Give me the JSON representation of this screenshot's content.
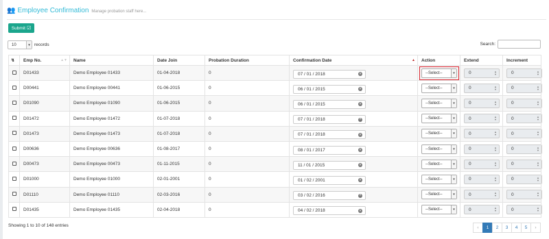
{
  "header": {
    "title": "Employee Confirmation",
    "subtitle": "Manage probation staff here...",
    "icon": "users-icon"
  },
  "toolbar": {
    "submit_label": "Submit"
  },
  "length": {
    "value": "10",
    "label": "records"
  },
  "search": {
    "label": "Search:",
    "value": ""
  },
  "columns": [
    "Emp No.",
    "Name",
    "Date Join",
    "Probation Duration",
    "Confirmation Date",
    "Action",
    "Extend",
    "Increment"
  ],
  "rows": [
    {
      "emp_no": "D01433",
      "name": "Demo Employee 01433",
      "date_join": "01-04-2018",
      "probation": "0",
      "confirm_date": "07 / 01 / 2018",
      "action": "--Select--",
      "extend": "0",
      "increment": "0"
    },
    {
      "emp_no": "D00441",
      "name": "Demo Employee 00441",
      "date_join": "01-06-2015",
      "probation": "0",
      "confirm_date": "06 / 01 / 2015",
      "action": "--Select--",
      "extend": "0",
      "increment": "0"
    },
    {
      "emp_no": "D01090",
      "name": "Demo Employee 01090",
      "date_join": "01-06-2015",
      "probation": "0",
      "confirm_date": "06 / 01 / 2015",
      "action": "--Select--",
      "extend": "0",
      "increment": "0"
    },
    {
      "emp_no": "D01472",
      "name": "Demo Employee 01472",
      "date_join": "01-07-2018",
      "probation": "0",
      "confirm_date": "07 / 01 / 2018",
      "action": "--Select--",
      "extend": "0",
      "increment": "0"
    },
    {
      "emp_no": "D01473",
      "name": "Demo Employee 01473",
      "date_join": "01-07-2018",
      "probation": "0",
      "confirm_date": "07 / 01 / 2018",
      "action": "--Select--",
      "extend": "0",
      "increment": "0"
    },
    {
      "emp_no": "D00636",
      "name": "Demo Employee 00636",
      "date_join": "01-08-2017",
      "probation": "0",
      "confirm_date": "08 / 01 / 2017",
      "action": "--Select--",
      "extend": "0",
      "increment": "0"
    },
    {
      "emp_no": "D00473",
      "name": "Demo Employee 00473",
      "date_join": "01-11-2015",
      "probation": "0",
      "confirm_date": "11 / 01 / 2015",
      "action": "--Select--",
      "extend": "0",
      "increment": "0"
    },
    {
      "emp_no": "D01000",
      "name": "Demo Employee 01000",
      "date_join": "02-01-2001",
      "probation": "0",
      "confirm_date": "01 / 02 / 2001",
      "action": "--Select--",
      "extend": "0",
      "increment": "0"
    },
    {
      "emp_no": "D01110",
      "name": "Demo Employee 01110",
      "date_join": "02-03-2016",
      "probation": "0",
      "confirm_date": "03 / 02 / 2016",
      "action": "--Select--",
      "extend": "0",
      "increment": "0"
    },
    {
      "emp_no": "D01435",
      "name": "Demo Employee 01435",
      "date_join": "02-04-2018",
      "probation": "0",
      "confirm_date": "04 / 02 / 2018",
      "action": "--Select--",
      "extend": "0",
      "increment": "0"
    }
  ],
  "footer": {
    "info": "Showing 1 to 10 of 148 entries"
  },
  "pagination": {
    "prev": "‹",
    "pages": [
      "1",
      "2",
      "3",
      "4",
      "5"
    ],
    "active": "1",
    "next": "›"
  },
  "colors": {
    "accent": "#2fb9d6",
    "submit": "#1aa58c",
    "highlight": "#d9232d",
    "page_active": "#337ab7"
  }
}
